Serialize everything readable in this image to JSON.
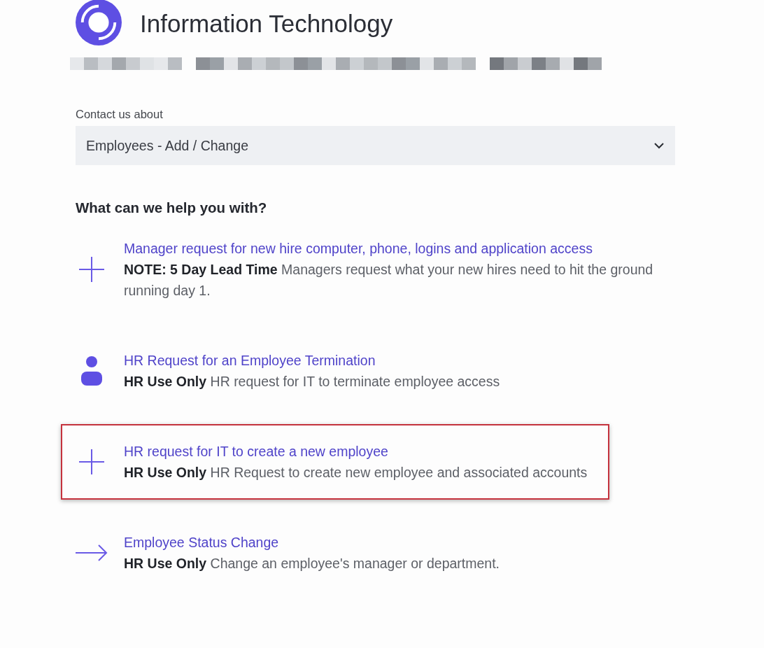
{
  "header": {
    "title": "Information Technology"
  },
  "topic_field": {
    "label": "Contact us about",
    "value": "Employees - Add / Change"
  },
  "options_heading": "What can we help you with?",
  "options": [
    {
      "kind": "plus",
      "title": "Manager request for new hire computer, phone, logins and application access",
      "description": "**NOTE: 5 Day Lead Time** Managers request what your new hires need to hit the ground running day 1.",
      "highlighted": false
    },
    {
      "kind": "person",
      "title": "HR Request for an Employee Termination",
      "description": "**HR Use Only** HR request for IT to terminate employee access",
      "highlighted": false
    },
    {
      "kind": "plus",
      "title": "HR request for IT to create a new employee",
      "description": "**HR Use Only** HR Request to create new employee and associated accounts",
      "highlighted": true
    },
    {
      "kind": "arrow",
      "title": "Employee Status Change",
      "description": "**HR Use Only** Change an employee's manager or department.",
      "highlighted": false
    }
  ]
}
